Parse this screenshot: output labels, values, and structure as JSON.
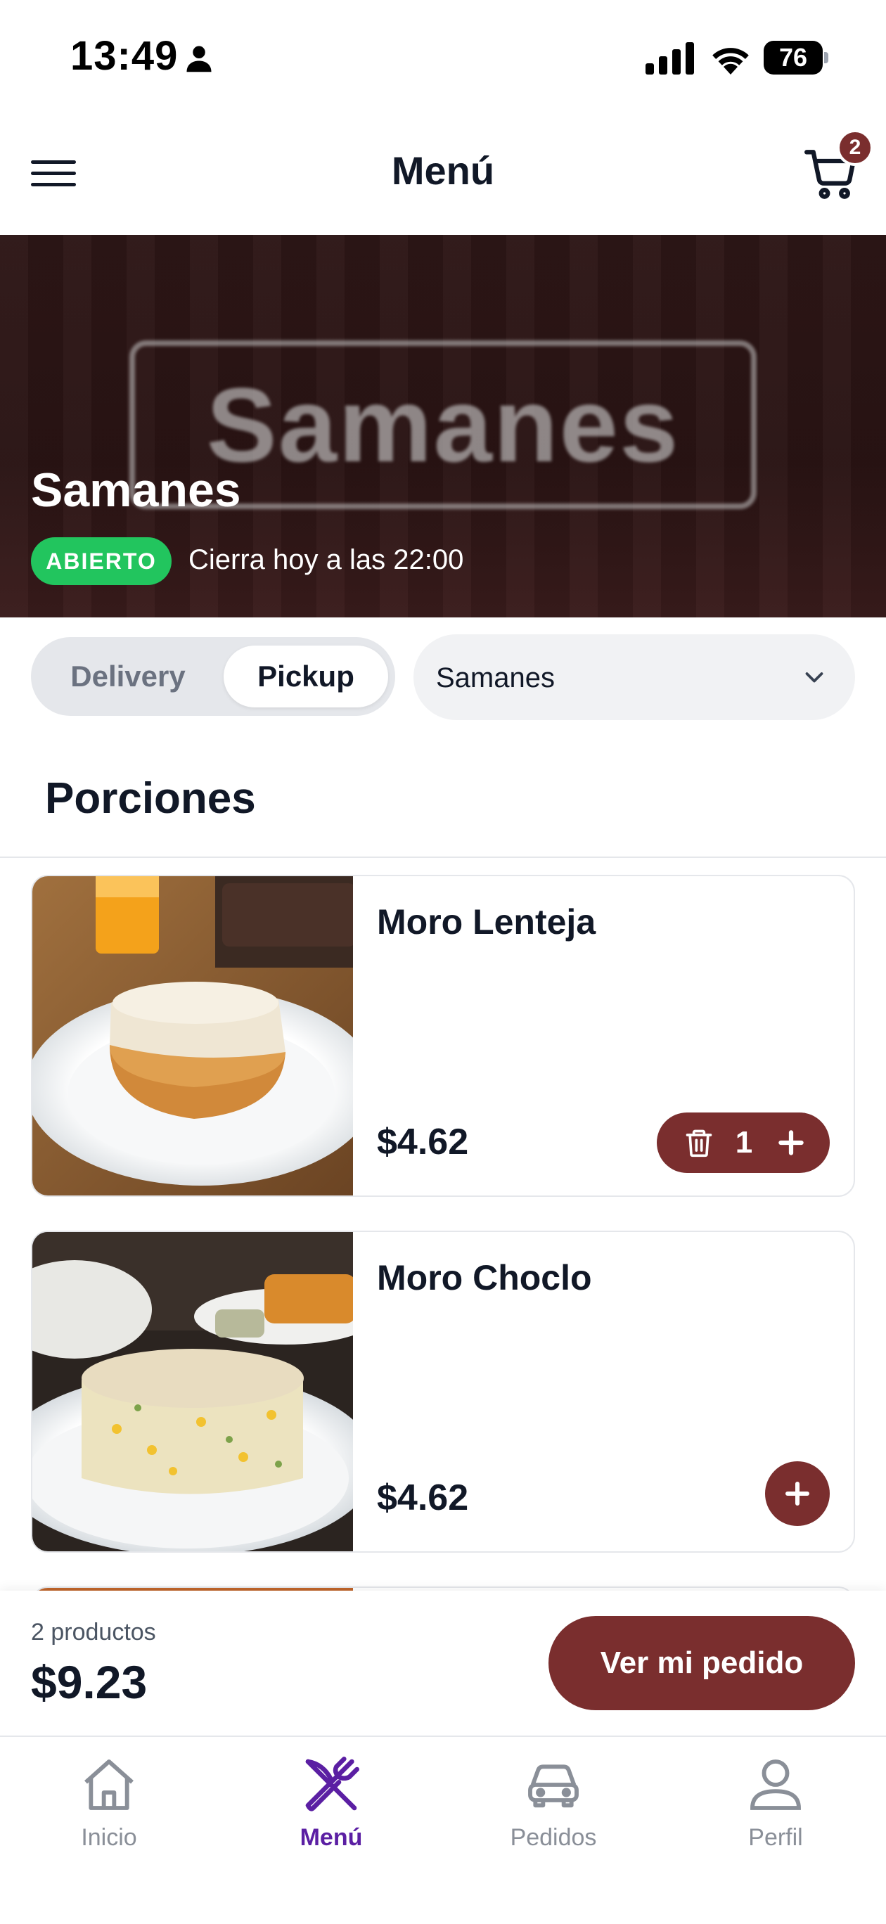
{
  "status_bar": {
    "time": "13:49",
    "battery": "76"
  },
  "header": {
    "title": "Menú",
    "cart_count": "2"
  },
  "hero": {
    "logo_text": "Samanes",
    "store_name": "Samanes",
    "status_badge": "ABIERTO",
    "hours": "Cierra hoy a las 22:00"
  },
  "mode_toggle": {
    "delivery": "Delivery",
    "pickup": "Pickup",
    "selected": "Pickup"
  },
  "branch_select": {
    "value": "Samanes"
  },
  "category": {
    "title": "Porciones"
  },
  "products": [
    {
      "name": "Moro Lenteja",
      "price": "$4.62",
      "quantity": "1"
    },
    {
      "name": "Moro Choclo",
      "price": "$4.62"
    }
  ],
  "order_bar": {
    "count_text": "2 productos",
    "total": "$9.23",
    "button_label": "Ver mi pedido"
  },
  "bottom_nav": [
    {
      "label": "Inicio",
      "icon": "home-icon"
    },
    {
      "label": "Menú",
      "icon": "utensils-icon",
      "active": true
    },
    {
      "label": "Pedidos",
      "icon": "car-icon"
    },
    {
      "label": "Perfil",
      "icon": "user-icon"
    }
  ],
  "colors": {
    "brand": "#7a2e2e",
    "open_green": "#22c55e",
    "nav_active": "#5b1fa3",
    "nav_inactive": "#8a8f98"
  }
}
